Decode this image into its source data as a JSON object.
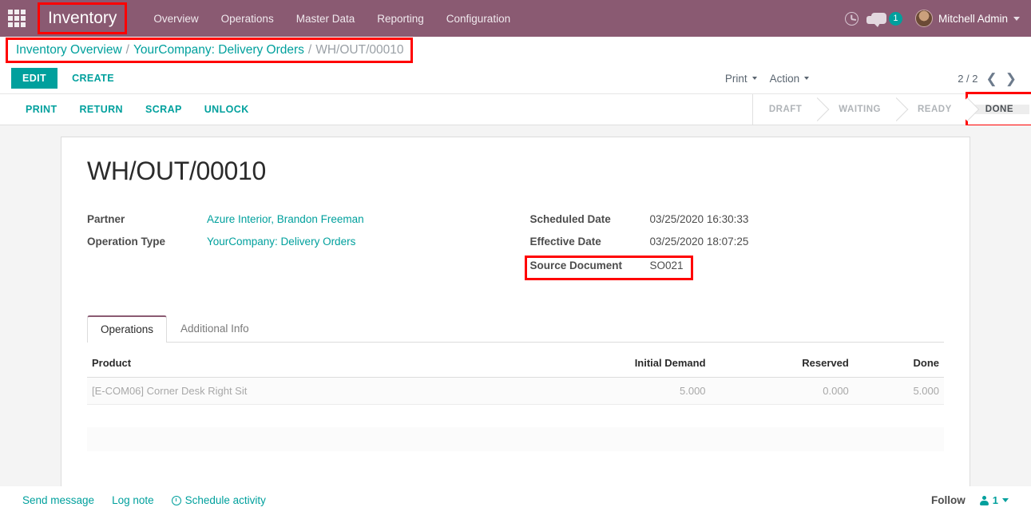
{
  "navbar": {
    "apps_icon": "apps-grid-icon",
    "brand": "Inventory",
    "menu": [
      {
        "label": "Overview"
      },
      {
        "label": "Operations"
      },
      {
        "label": "Master Data"
      },
      {
        "label": "Reporting"
      },
      {
        "label": "Configuration"
      }
    ],
    "activity_icon": "clock-icon",
    "messages_icon": "chat-bubble-icon",
    "messages_count": "1",
    "user_name": "Mitchell Admin",
    "brand_color": "#8a5a72",
    "accent_color": "#00A09D"
  },
  "breadcrumb": {
    "root": "Inventory Overview",
    "sep": "/",
    "parent": "YourCompany: Delivery Orders",
    "current": "WH/OUT/00010"
  },
  "controls": {
    "edit_label": "EDIT",
    "create_label": "CREATE",
    "print_label": "Print",
    "action_label": "Action",
    "pager_text": "2 / 2",
    "prev_icon": "chevron-left-icon",
    "next_icon": "chevron-right-icon"
  },
  "statusbar": {
    "buttons": [
      {
        "label": "PRINT"
      },
      {
        "label": "RETURN"
      },
      {
        "label": "SCRAP"
      },
      {
        "label": "UNLOCK"
      }
    ],
    "stages": [
      {
        "label": "DRAFT",
        "active": false
      },
      {
        "label": "WAITING",
        "active": false
      },
      {
        "label": "READY",
        "active": false
      },
      {
        "label": "DONE",
        "active": true
      }
    ]
  },
  "record": {
    "title": "WH/OUT/00010",
    "left_fields": [
      {
        "label": "Partner",
        "value": "Azure Interior, Brandon Freeman",
        "link": true
      },
      {
        "label": "Operation Type",
        "value": "YourCompany: Delivery Orders",
        "link": true
      }
    ],
    "right_fields": [
      {
        "label": "Scheduled Date",
        "value": "03/25/2020 16:30:33",
        "link": false
      },
      {
        "label": "Effective Date",
        "value": "03/25/2020 18:07:25",
        "link": false
      },
      {
        "label": "Source Document",
        "value": "SO021",
        "link": false,
        "highlight": true
      }
    ]
  },
  "notebook": {
    "tabs": [
      {
        "label": "Operations",
        "active": true
      },
      {
        "label": "Additional Info",
        "active": false
      }
    ],
    "table": {
      "headers": [
        "Product",
        "Initial Demand",
        "Reserved",
        "Done"
      ],
      "rows": [
        {
          "product": "[E-COM06] Corner Desk Right Sit",
          "initial_demand": "5.000",
          "reserved": "0.000",
          "done": "5.000"
        }
      ]
    }
  },
  "chatter": {
    "send_message": "Send message",
    "log_note": "Log note",
    "schedule_activity": "Schedule activity",
    "schedule_icon": "clock-icon",
    "follow_label": "Follow",
    "followers_icon": "person-icon",
    "followers_count": "1"
  }
}
